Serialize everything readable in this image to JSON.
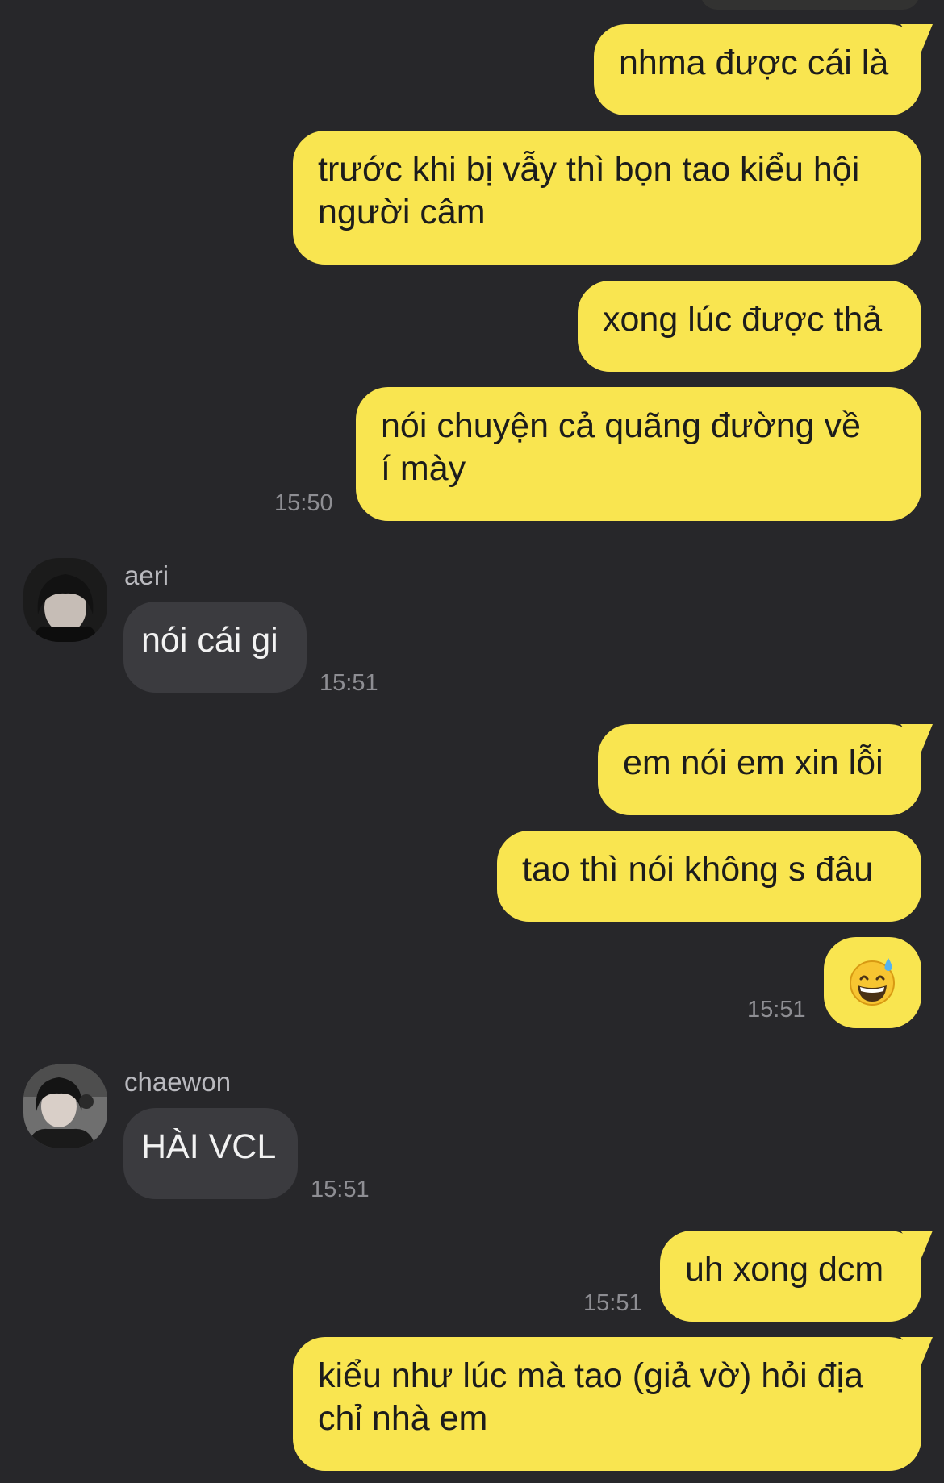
{
  "messages": [
    {
      "side": "out",
      "text": "nhma được cái là"
    },
    {
      "side": "out",
      "lines": [
        "trước khi bị vẫy thì bọn tao kiểu hội",
        "người câm"
      ]
    },
    {
      "side": "out",
      "text": "xong lúc được thả"
    },
    {
      "side": "out",
      "lines": [
        "nói chuyện cả quãng đường về",
        "í mày"
      ],
      "time": "15:50"
    },
    {
      "side": "in",
      "sender": "aeri",
      "text": "nói cái gi",
      "time": "15:51"
    },
    {
      "side": "out",
      "text": "em nói em xin lỗi"
    },
    {
      "side": "out",
      "text": "tao thì nói không s đâu"
    },
    {
      "side": "out",
      "emoji": "grinning-face-with-sweat",
      "time": "15:51"
    },
    {
      "side": "in",
      "sender": "chaewon",
      "text": "HÀI VCL",
      "time": "15:51"
    },
    {
      "side": "out",
      "text": "uh xong dcm",
      "time": "15:51"
    },
    {
      "side": "out",
      "lines": [
        "kiểu như lúc mà tao (giả vờ) hỏi địa",
        "chỉ nhà em"
      ]
    }
  ],
  "colors": {
    "background": "#27272a",
    "outgoing_bubble": "#f9e550",
    "incoming_bubble": "#3b3b3f",
    "timestamp": "#8e8e93"
  }
}
